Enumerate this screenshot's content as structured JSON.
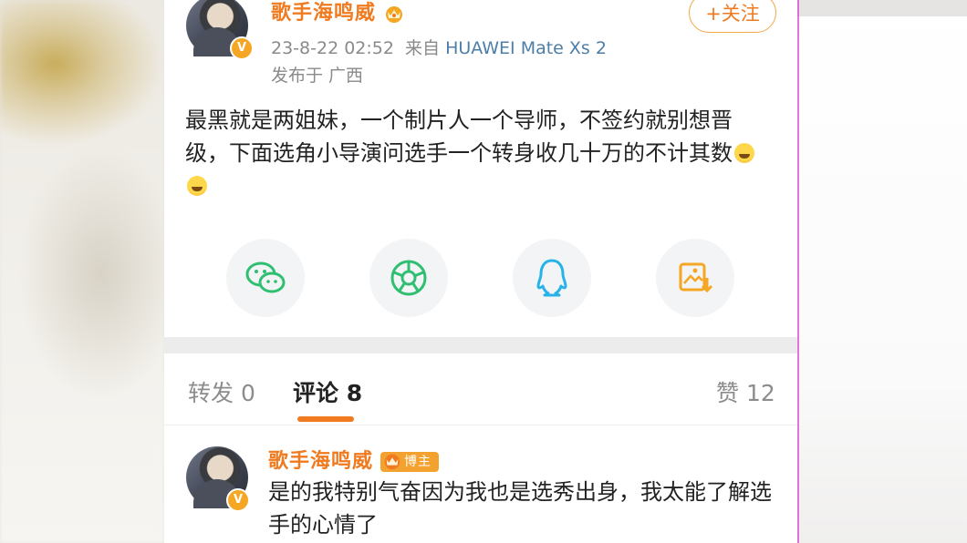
{
  "post": {
    "username": "歌手海鸣威",
    "verified_mark": "V",
    "timestamp": "23-8-22 02:52",
    "source_prefix": "来自",
    "device": "HUAWEI Mate Xs 2",
    "location": "发布于 广西",
    "follow_label": "+关注",
    "content": "最黑就是两姐妹，一个制片人一个导师，不签约就别想晋级，下面选角小导演问选手一个转身收几十万的不计其数"
  },
  "share_buttons": [
    {
      "icon": "wechat-icon",
      "color": "#2fbf71"
    },
    {
      "icon": "moments-icon",
      "color": "#2fbf71"
    },
    {
      "icon": "qq-icon",
      "color": "#28b3e8"
    },
    {
      "icon": "save-image-icon",
      "color": "#f5a623"
    }
  ],
  "tabs": {
    "repost_label": "转发",
    "repost_count": "0",
    "comment_label": "评论",
    "comment_count": "8",
    "like_label": "赞",
    "like_count": "12"
  },
  "comment": {
    "username": "歌手海鸣威",
    "badge": "博主",
    "verified_mark": "V",
    "content": "是的我特别气奋因为我也是选秀出身，我太能了解选手的心情了"
  },
  "colors": {
    "accent_orange": "#f07a1f",
    "device_blue": "#4d7ea8",
    "wechat_green": "#2fbf71",
    "qq_blue": "#28b3e8"
  }
}
